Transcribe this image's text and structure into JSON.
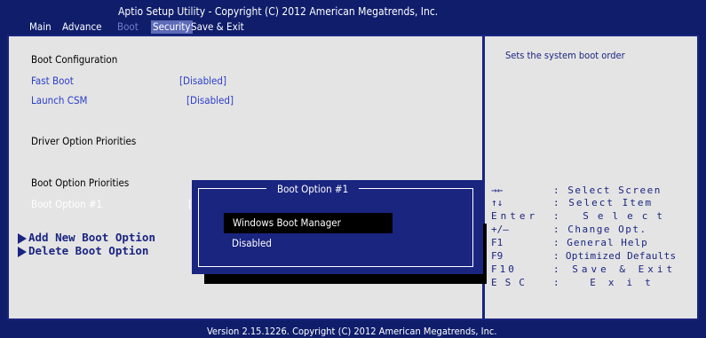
{
  "header": {
    "title": "Aptio Setup Utility - Copyright (C) 2012 American Megatrends, Inc.",
    "menu": [
      "Main",
      "Advance",
      "Boot",
      "Security",
      "Save & Exit"
    ]
  },
  "left_panel": {
    "boot_configuration": "Boot Configuration",
    "fast_boot_label": "Fast Boot",
    "fast_boot_value": "[Disabled]",
    "launch_csm_label": "Launch CSM",
    "launch_csm_value": "[Disabled]",
    "driver_option_priorities": "Driver Option Priorities",
    "boot_option_priorities": "Boot Option Priorities",
    "boot_option_1_label": "Boot Option #1",
    "boot_option_1_value": "[\\",
    "add_new_boot_option": "Add New Boot Option",
    "delete_boot_option": "Delete Boot Option"
  },
  "popup": {
    "title": "Boot Option #1",
    "options": [
      "Windows Boot Manager",
      "Disabled"
    ]
  },
  "right_panel": {
    "help_text": "Sets the system boot order",
    "keys": [
      {
        "key": "→←",
        "desc": ": Select Screen"
      },
      {
        "key": "↑↓",
        "desc": ": Select Item"
      },
      {
        "key": "Enter",
        "desc": ": Select"
      },
      {
        "key": "+/—",
        "desc": ": Change Opt."
      },
      {
        "key": "F1",
        "desc": ": General Help"
      },
      {
        "key": "F9",
        "desc": ": Optimized Defaults"
      },
      {
        "key": "F10",
        "desc": ": Save & Exit"
      },
      {
        "key": "ESC",
        "desc": ": Exit"
      }
    ]
  },
  "footer": {
    "version": "Version 2.15.1226. Copyright (C) 2012 American Megatrends, Inc."
  }
}
